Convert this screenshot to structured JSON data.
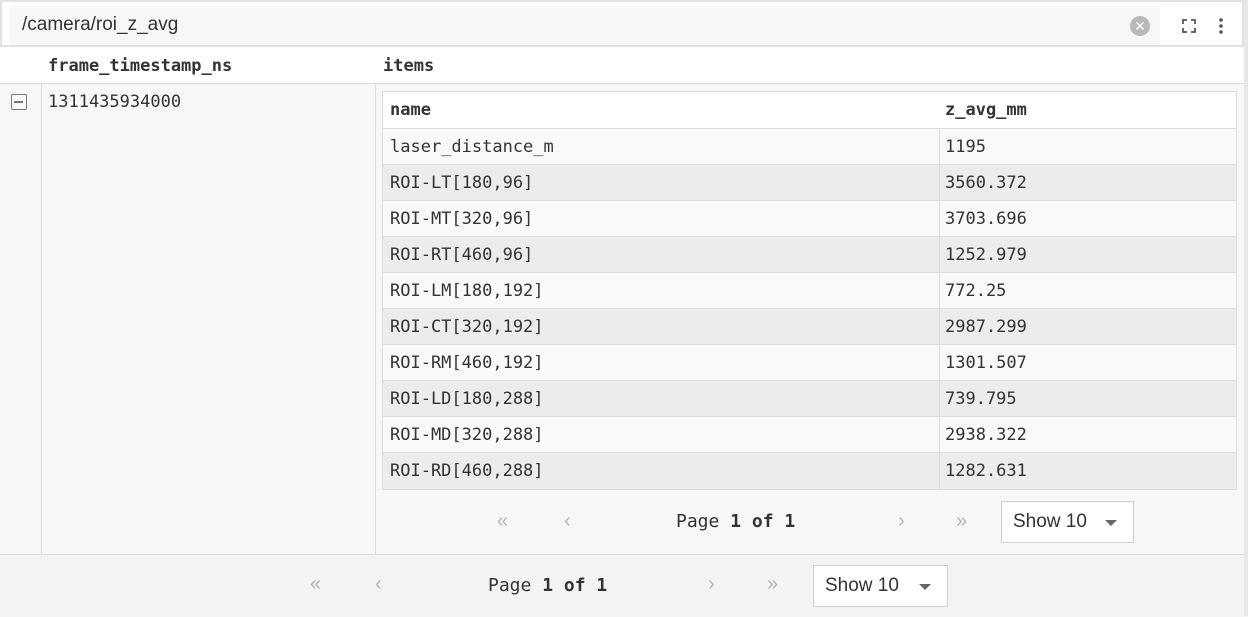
{
  "header": {
    "topic": "/camera/roi_z_avg"
  },
  "outer_table": {
    "columns": [
      "frame_timestamp_ns",
      "items"
    ],
    "row": {
      "frame_timestamp_ns": "1311435934000"
    }
  },
  "inner_table": {
    "columns": [
      "name",
      "z_avg_mm"
    ],
    "rows": [
      {
        "name": "laser_distance_m",
        "z_avg_mm": "1195"
      },
      {
        "name": "ROI-LT[180,96]",
        "z_avg_mm": "3560.372"
      },
      {
        "name": "ROI-MT[320,96]",
        "z_avg_mm": "3703.696"
      },
      {
        "name": "ROI-RT[460,96]",
        "z_avg_mm": "1252.979"
      },
      {
        "name": "ROI-LM[180,192]",
        "z_avg_mm": "772.25"
      },
      {
        "name": "ROI-CT[320,192]",
        "z_avg_mm": "2987.299"
      },
      {
        "name": "ROI-RM[460,192]",
        "z_avg_mm": "1301.507"
      },
      {
        "name": "ROI-LD[180,288]",
        "z_avg_mm": "739.795"
      },
      {
        "name": "ROI-MD[320,288]",
        "z_avg_mm": "2938.322"
      },
      {
        "name": "ROI-RD[460,288]",
        "z_avg_mm": "1282.631"
      }
    ],
    "pagination": {
      "page_word": "Page",
      "page_current": "1",
      "of_word": "of",
      "page_total": "1",
      "show_label": "Show 10"
    }
  },
  "outer_pagination": {
    "page_word": "Page",
    "page_current": "1",
    "of_word": "of",
    "page_total": "1",
    "show_label": "Show 10"
  },
  "icons": {
    "clear": "clear-icon",
    "expand": "expand-icon",
    "more": "more-vertical-icon",
    "collapse": "collapse-row-icon",
    "first": "first-page-icon",
    "prev": "previous-page-icon",
    "next": "next-page-icon",
    "last": "last-page-icon"
  }
}
